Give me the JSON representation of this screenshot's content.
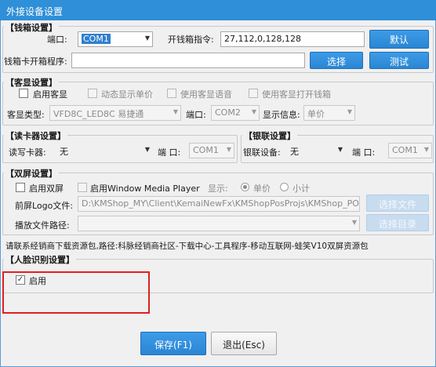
{
  "window": {
    "title": "外接设备设置"
  },
  "cash_drawer": {
    "legend": "【钱箱设置】",
    "port_label": "端口:",
    "port_value": "COM1",
    "command_label": "开钱箱指令:",
    "command_value": "27,112,0,128,128",
    "default_button": "默认",
    "card_program_label": "钱箱卡开箱程序:",
    "card_program_value": "",
    "choose_button": "选择",
    "test_button": "测试"
  },
  "customer_display": {
    "legend": "【客显设置】",
    "enable_label": "启用客显",
    "dynamic_price_label": "动态显示单价",
    "voice_label": "使用客显语音",
    "open_drawer_label": "使用客显打开钱箱",
    "type_label": "客显类型:",
    "type_value": "VFD8C_LED8C 易捷通",
    "port_label": "端口:",
    "port_value": "COM2",
    "info_label": "显示信息:",
    "info_value": "单价"
  },
  "card_reader": {
    "legend": "【读卡器设置】",
    "reader_label": "读写卡器:",
    "reader_value": "无",
    "port_label": "端 口:",
    "port_value": "COM1"
  },
  "union_pay": {
    "legend": "【银联设置】",
    "device_label": "银联设备:",
    "device_value": "无",
    "port_label": "端 口:",
    "port_value": "COM1"
  },
  "dual_screen": {
    "legend": "【双屏设置】",
    "enable_label": "启用双屏",
    "wmp_label": "启用Window Media Player",
    "show_label": "显示:",
    "unit_price_label": "单价",
    "subtotal_label": "小计",
    "logo_label": "前屏Logo文件:",
    "logo_value": "D:\\KMShop_MY\\Client\\KemaiNewFx\\KMShopPosProjs\\KMShop_POS",
    "choose_file_button": "选择文件",
    "playlist_label": "播放文件路径:",
    "playlist_value": "",
    "choose_dir_button": "选择目录"
  },
  "notice": {
    "text": "请联系经销商下载资源包,路径:科脉经销商社区-下载中心-工具程序-移动互联网-蛙笑V10双屏资源包"
  },
  "face_recognition": {
    "legend": "【人脸识别设置】",
    "enable_label": "启用",
    "enable_checked": true
  },
  "footer": {
    "save_button": "保存(F1)",
    "exit_button": "退出(Esc)"
  },
  "colors": {
    "accent": "#2f8fd8",
    "highlight_border": "#e02020"
  }
}
